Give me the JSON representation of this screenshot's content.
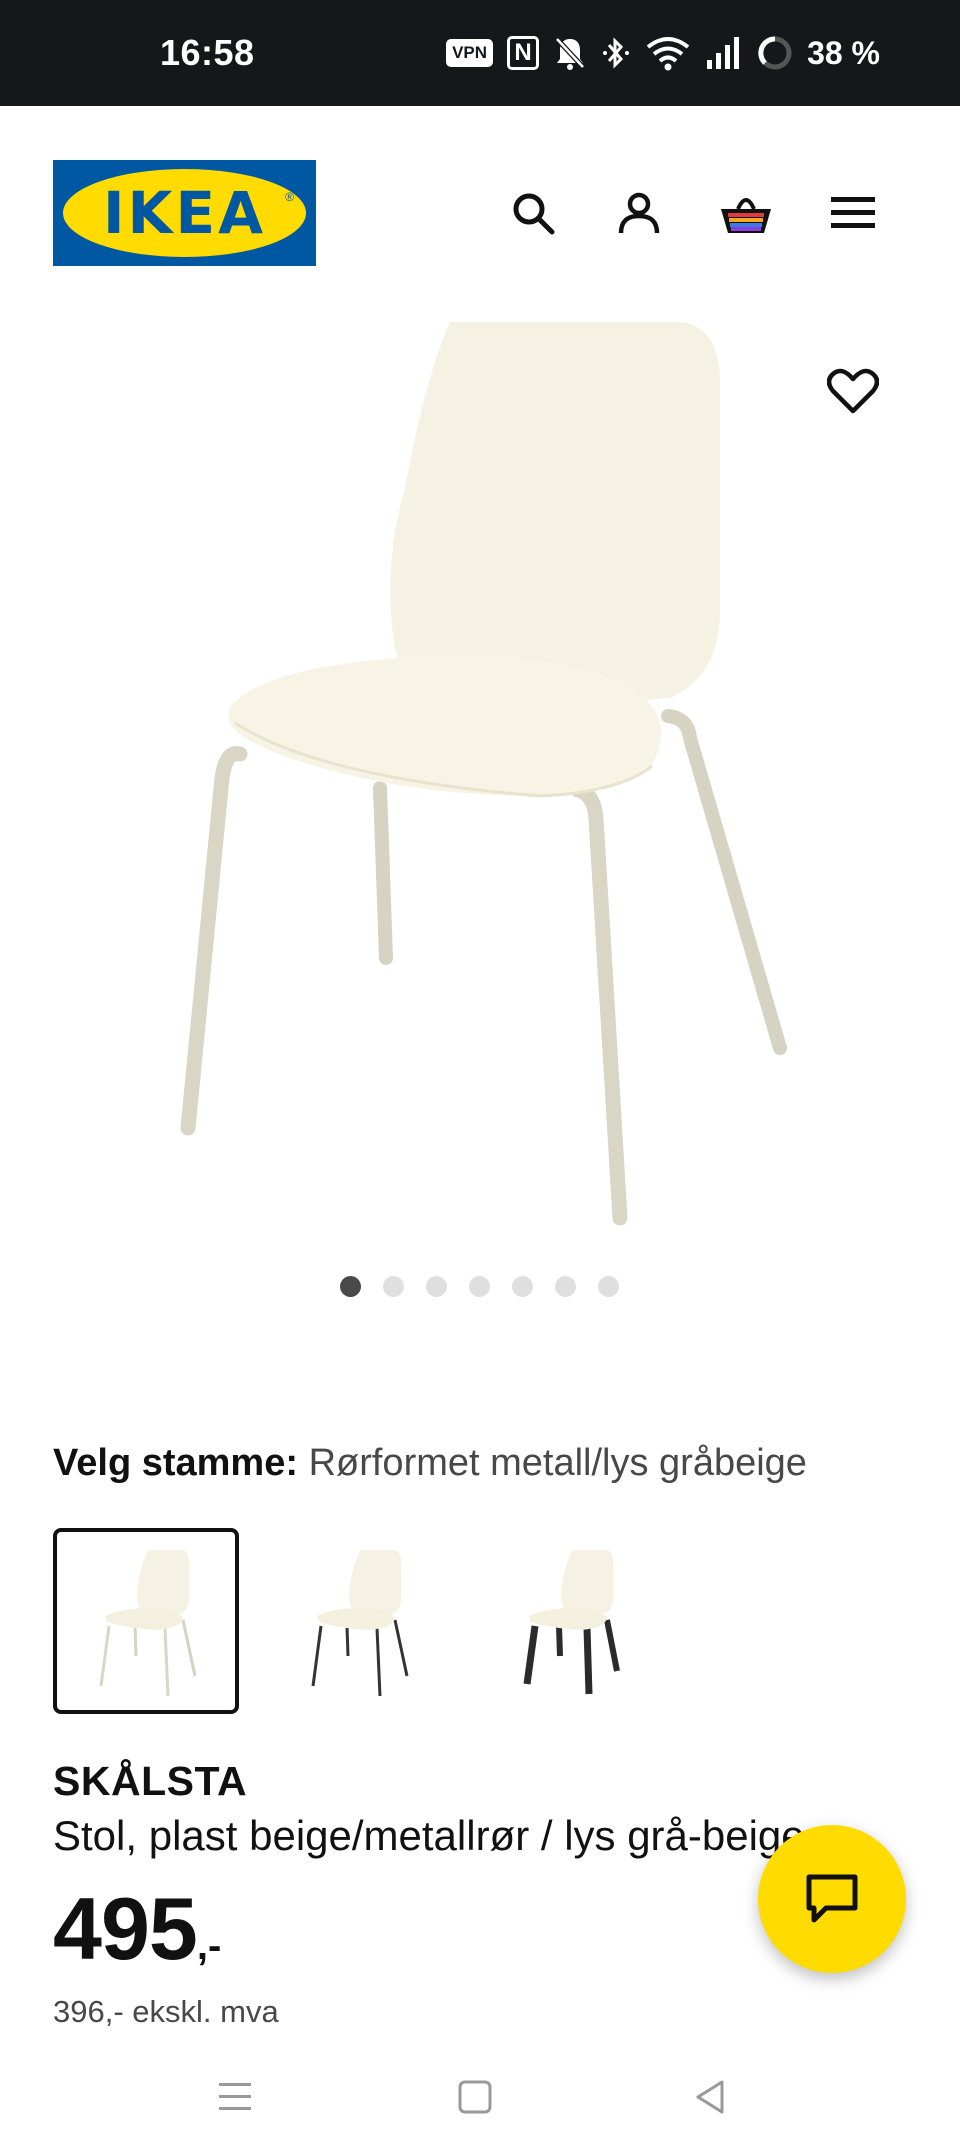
{
  "status_bar": {
    "time": "16:58",
    "vpn": "VPN",
    "nfc": "N",
    "battery_percent": "38 %",
    "icons": [
      "vpn-icon",
      "nfc-icon",
      "bell-muted-icon",
      "bluetooth-icon",
      "wifi-icon",
      "signal-icon",
      "battery-ring-icon"
    ]
  },
  "header": {
    "logo_text": "IKEA",
    "logo_reg": "®",
    "icons": [
      "search-icon",
      "account-icon",
      "cart-icon",
      "menu-icon"
    ],
    "brand_colors": {
      "blue": "#0058a3",
      "yellow": "#ffdb00"
    }
  },
  "product": {
    "image_icon": "chair-image",
    "image_count": 7,
    "active_image_index": 0,
    "stem_label": "Velg stamme:",
    "stem_value": "Rørformet metall/lys gråbeige",
    "variants": [
      {
        "name": "variant-beige-legs",
        "selected": true
      },
      {
        "name": "variant-black-metal-legs",
        "selected": false
      },
      {
        "name": "variant-black-wood-legs",
        "selected": false
      }
    ],
    "name": "SKÅLSTA",
    "description": "Stol, plast beige/metallrør / lys grå-beige",
    "price_main": "495",
    "price_suffix": ",-",
    "price_ex_vat": "396,- ekskl. mva"
  },
  "chat": {
    "icon": "chat-bubble-icon"
  },
  "nav_bar": {
    "icons": [
      "recents-icon",
      "home-icon",
      "back-icon"
    ]
  }
}
